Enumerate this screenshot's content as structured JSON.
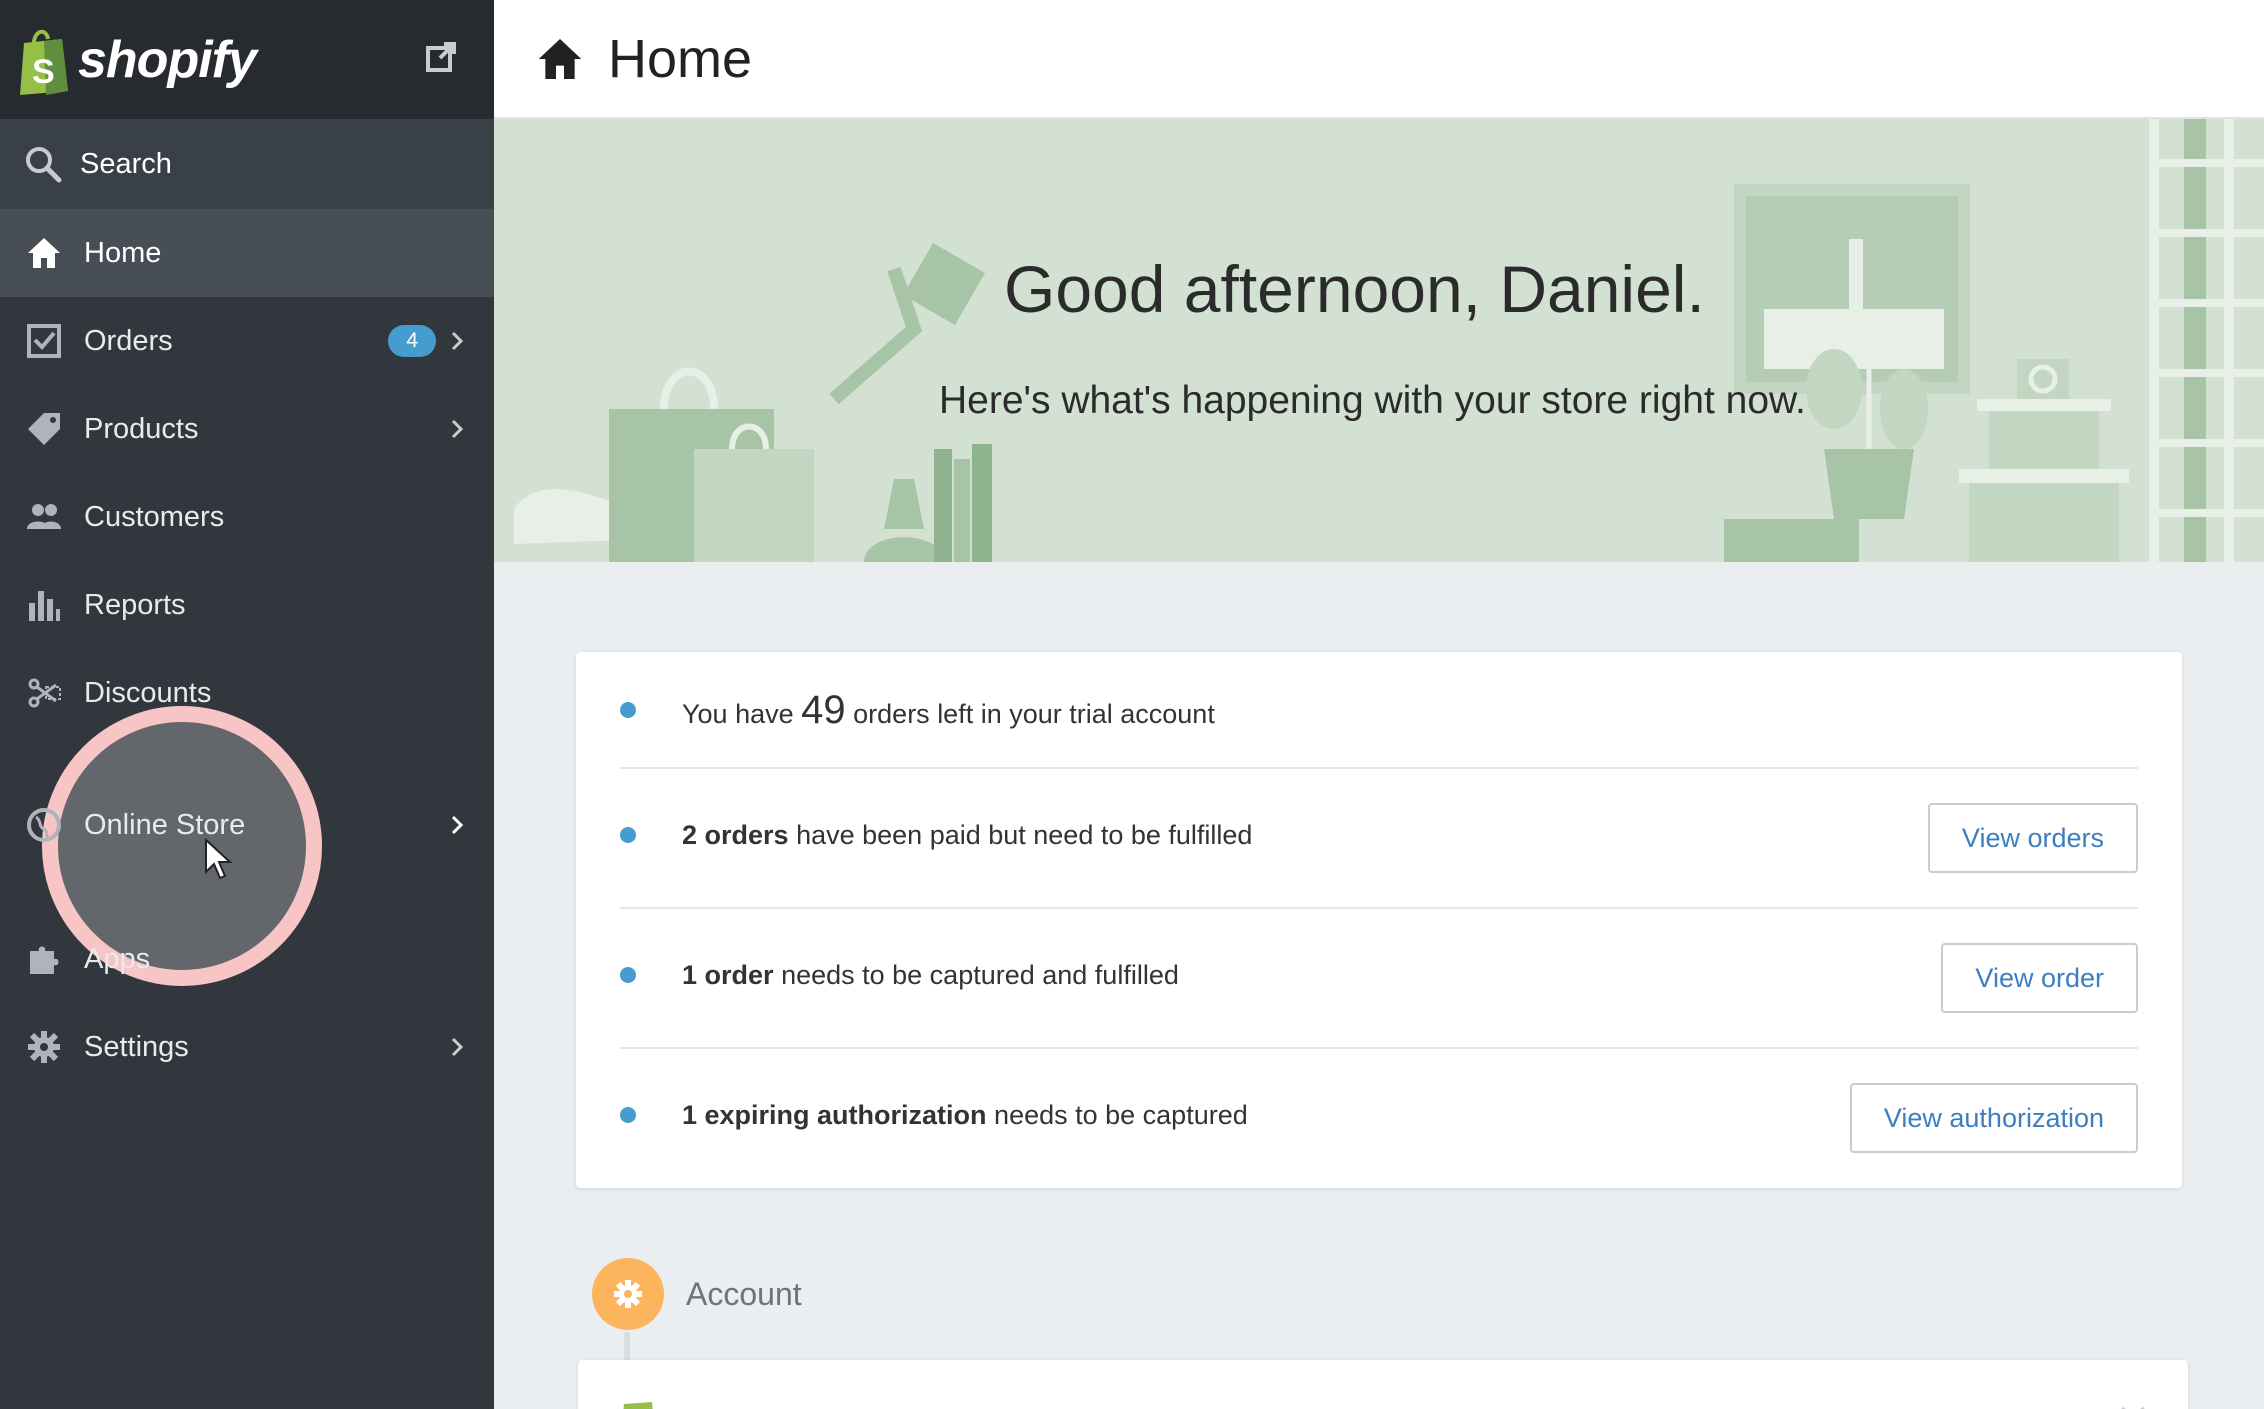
{
  "sidebar": {
    "brand": "shopify",
    "search_label": "Search",
    "items": [
      {
        "label": "Home",
        "active": true
      },
      {
        "label": "Orders",
        "badge": "4"
      },
      {
        "label": "Products"
      },
      {
        "label": "Customers"
      },
      {
        "label": "Reports"
      },
      {
        "label": "Discounts"
      },
      {
        "label": "Online Store"
      },
      {
        "label": "Apps"
      },
      {
        "label": "Settings"
      }
    ]
  },
  "header": {
    "title": "Home",
    "icon": "home-icon"
  },
  "hero": {
    "greeting": "Good afternoon, Daniel.",
    "subtitle": "Here's what's happening with your store right now."
  },
  "tasks": {
    "trial": {
      "pre": "You have",
      "count": "49",
      "post": "orders left in your trial account"
    },
    "paid": {
      "bold": "2 orders",
      "text": "have been paid but need to be fulfilled",
      "button": "View orders"
    },
    "capture": {
      "bold": "1 order",
      "text": "needs to be captured and fulfilled",
      "button": "View order"
    },
    "auth": {
      "bold": "1 expiring authorization",
      "text": "needs to be captured",
      "button": "View authorization"
    }
  },
  "account": {
    "label": "Account"
  },
  "colors": {
    "sidebar": "#31373d",
    "accent": "#479ccf",
    "hero": "#d3e1d3",
    "highlight": "#f7c5c6",
    "account_icon": "#fcb45d"
  }
}
